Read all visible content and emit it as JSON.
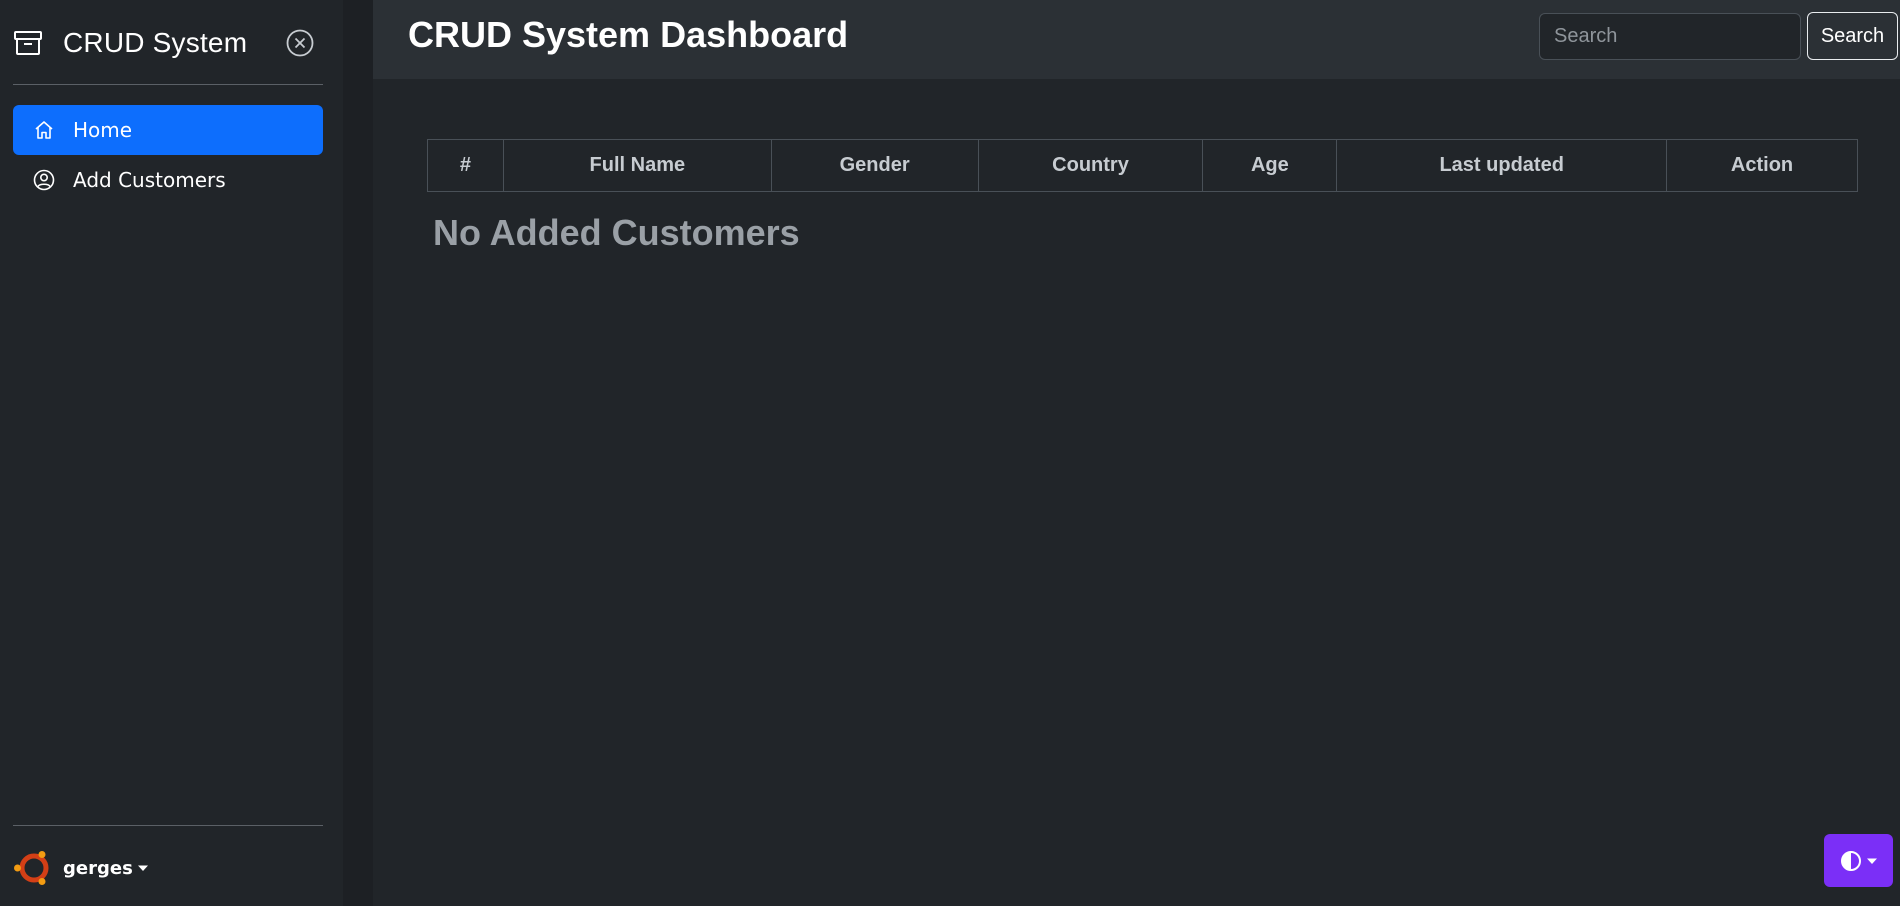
{
  "sidebar": {
    "brand": {
      "title": "CRUD System",
      "icon": "archive-icon"
    },
    "close_icon": "close-circle-icon",
    "nav": [
      {
        "label": "Home",
        "icon": "house-icon",
        "active": true
      },
      {
        "label": "Add Customers",
        "icon": "person-circle-icon",
        "active": false
      }
    ],
    "user": {
      "name": "gerges",
      "icon": "ubuntu-avatar-icon"
    }
  },
  "header": {
    "title": "CRUD System Dashboard",
    "search": {
      "placeholder": "Search",
      "value": ""
    },
    "search_button": "Search"
  },
  "table": {
    "columns": [
      "#",
      "Full Name",
      "Gender",
      "Country",
      "Age",
      "Last updated",
      "Action"
    ],
    "rows": []
  },
  "empty_message": "No Added Customers",
  "theme_toggle": {
    "icon": "circle-half-icon"
  },
  "colors": {
    "accent": "#0d6efd",
    "theme_button": "#7b2ff7",
    "background": "#212529",
    "header": "#2b3035"
  }
}
